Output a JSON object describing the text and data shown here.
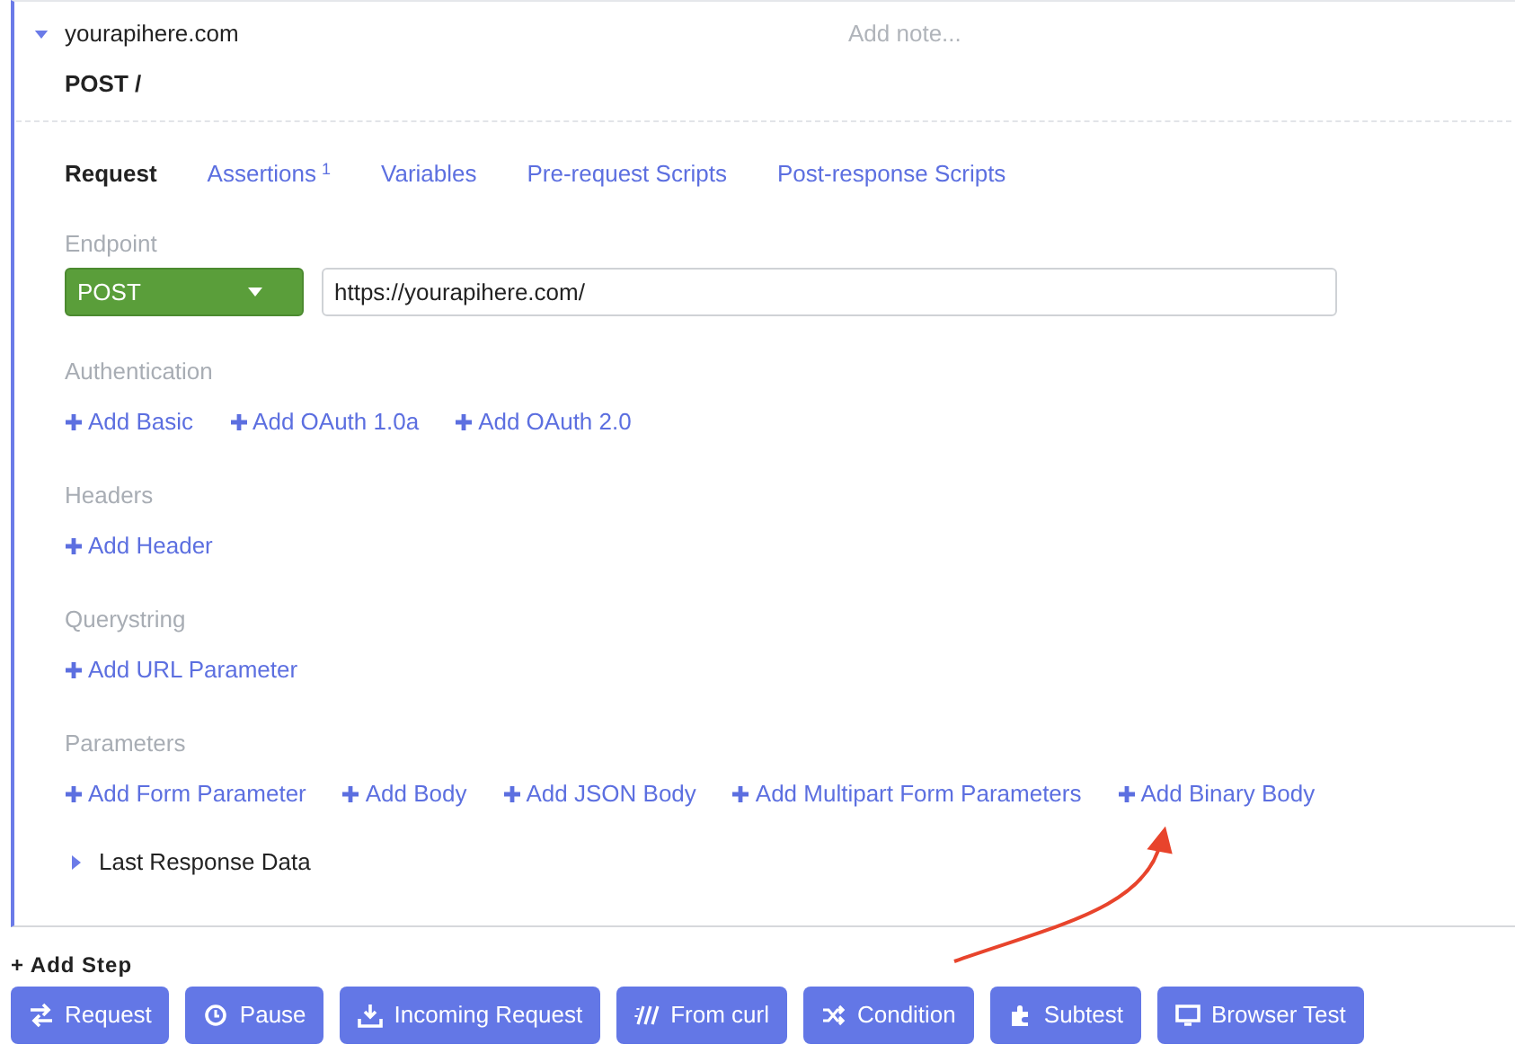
{
  "step": {
    "expanded": true,
    "host": "yourapihere.com",
    "note_placeholder": "Add note...",
    "title": "POST /"
  },
  "tabs": [
    {
      "label": "Request",
      "selected": true
    },
    {
      "label": "Assertions",
      "sup": "1",
      "selected": false
    },
    {
      "label": "Variables",
      "selected": false
    },
    {
      "label": "Pre-request Scripts",
      "selected": false
    },
    {
      "label": "Post-response Scripts",
      "selected": false
    }
  ],
  "endpoint": {
    "label": "Endpoint",
    "method": "POST",
    "url": "https://yourapihere.com/"
  },
  "sections": [
    {
      "label": "Authentication",
      "links": [
        "Add Basic",
        "Add OAuth 1.0a",
        "Add OAuth 2.0"
      ]
    },
    {
      "label": "Headers",
      "links": [
        "Add Header"
      ]
    },
    {
      "label": "Querystring",
      "links": [
        "Add URL Parameter"
      ]
    },
    {
      "label": "Parameters",
      "links": [
        "Add Form Parameter",
        "Add Body",
        "Add JSON Body",
        "Add Multipart Form Parameters",
        "Add Binary Body"
      ]
    }
  ],
  "last_response": {
    "label": "Last Response Data",
    "expanded": false
  },
  "add_step": {
    "label": "+ Add Step",
    "buttons": [
      "Request",
      "Pause",
      "Incoming Request",
      "From curl",
      "Condition",
      "Subtest",
      "Browser Test"
    ]
  }
}
